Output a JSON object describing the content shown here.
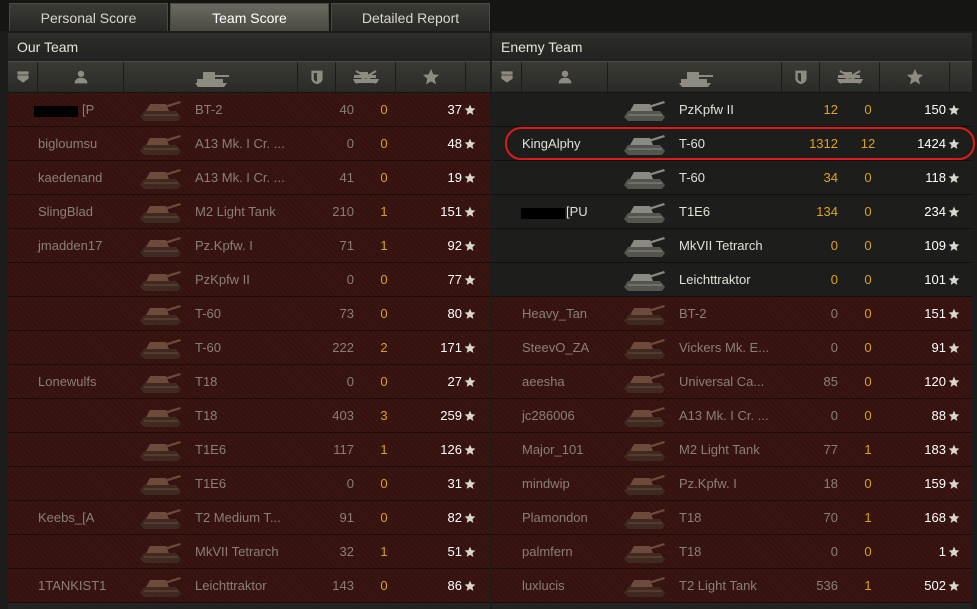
{
  "tabs": [
    {
      "label": "Personal Score",
      "active": false
    },
    {
      "label": "Team Score",
      "active": true
    },
    {
      "label": "Detailed Report",
      "active": false
    }
  ],
  "our_team": {
    "title": "Our Team",
    "rows": [
      {
        "name": "[P",
        "masked": true,
        "tank": "BT-2",
        "damage": "40",
        "kills": "0",
        "score": "37",
        "alive": false
      },
      {
        "name": "bigloumsu",
        "masked": false,
        "tank": "A13 Mk. I Cr. ...",
        "damage": "0",
        "kills": "0",
        "score": "48",
        "alive": false
      },
      {
        "name": "kaedenand",
        "masked": false,
        "tank": "A13 Mk. I Cr. ...",
        "damage": "41",
        "kills": "0",
        "score": "19",
        "alive": false
      },
      {
        "name": "SlingBlad",
        "masked": false,
        "tank": "M2 Light Tank",
        "damage": "210",
        "kills": "1",
        "score": "151",
        "alive": false
      },
      {
        "name": "jmadden17",
        "masked": false,
        "tank": "Pz.Kpfw. I",
        "damage": "71",
        "kills": "1",
        "score": "92",
        "alive": false
      },
      {
        "name": "",
        "masked": true,
        "tank": "PzKpfw II",
        "damage": "0",
        "kills": "0",
        "score": "77",
        "alive": false
      },
      {
        "name": "",
        "masked": true,
        "tank": "T-60",
        "damage": "73",
        "kills": "0",
        "score": "80",
        "alive": false
      },
      {
        "name": "",
        "masked": true,
        "tank": "T-60",
        "damage": "222",
        "kills": "2",
        "score": "171",
        "alive": false
      },
      {
        "name": "Lonewulfs",
        "masked": false,
        "tank": "T18",
        "damage": "0",
        "kills": "0",
        "score": "27",
        "alive": false
      },
      {
        "name": "",
        "masked": true,
        "tank": "T18",
        "damage": "403",
        "kills": "3",
        "score": "259",
        "alive": false
      },
      {
        "name": "",
        "masked": true,
        "tank": "T1E6",
        "damage": "117",
        "kills": "1",
        "score": "126",
        "alive": false
      },
      {
        "name": "",
        "masked": true,
        "tank": "T1E6",
        "damage": "0",
        "kills": "0",
        "score": "31",
        "alive": false
      },
      {
        "name": "Keebs_[A",
        "masked": false,
        "tank": "T2 Medium T...",
        "damage": "91",
        "kills": "0",
        "score": "82",
        "alive": false
      },
      {
        "name": "",
        "masked": true,
        "tank": "MkVII Tetrarch",
        "damage": "32",
        "kills": "1",
        "score": "51",
        "alive": false
      },
      {
        "name": "1TANKIST1",
        "masked": false,
        "tank": "Leichttraktor",
        "damage": "143",
        "kills": "0",
        "score": "86",
        "alive": false
      }
    ]
  },
  "enemy_team": {
    "title": "Enemy Team",
    "rows": [
      {
        "name": "",
        "masked": true,
        "tank": "PzKpfw II",
        "damage": "12",
        "kills": "0",
        "score": "150",
        "alive": true
      },
      {
        "name": "KingAlphy",
        "masked": false,
        "tank": "T-60",
        "damage": "1312",
        "kills": "12",
        "score": "1424",
        "alive": true
      },
      {
        "name": "",
        "masked": true,
        "tank": "T-60",
        "damage": "34",
        "kills": "0",
        "score": "118",
        "alive": true
      },
      {
        "name": "[PU",
        "masked": true,
        "tank": "T1E6",
        "damage": "134",
        "kills": "0",
        "score": "234",
        "alive": true
      },
      {
        "name": "",
        "masked": true,
        "tank": "MkVII Tetrarch",
        "damage": "0",
        "kills": "0",
        "score": "109",
        "alive": true
      },
      {
        "name": "",
        "masked": true,
        "tank": "Leichttraktor",
        "damage": "0",
        "kills": "0",
        "score": "101",
        "alive": true
      },
      {
        "name": "Heavy_Tan",
        "masked": false,
        "tank": "BT-2",
        "damage": "0",
        "kills": "0",
        "score": "151",
        "alive": false
      },
      {
        "name": "SteevO_ZA",
        "masked": false,
        "tank": "Vickers Mk. E...",
        "damage": "0",
        "kills": "0",
        "score": "91",
        "alive": false
      },
      {
        "name": "aeesha",
        "masked": false,
        "tank": "Universal Ca...",
        "damage": "85",
        "kills": "0",
        "score": "120",
        "alive": false
      },
      {
        "name": "jc286006",
        "masked": false,
        "tank": "A13 Mk. I Cr. ...",
        "damage": "0",
        "kills": "0",
        "score": "88",
        "alive": false
      },
      {
        "name": "Major_101",
        "masked": false,
        "tank": "M2 Light Tank",
        "damage": "77",
        "kills": "1",
        "score": "183",
        "alive": false
      },
      {
        "name": "mindwip",
        "masked": false,
        "tank": "Pz.Kpfw. I",
        "damage": "18",
        "kills": "0",
        "score": "159",
        "alive": false
      },
      {
        "name": "Plamondon",
        "masked": false,
        "tank": "T18",
        "damage": "70",
        "kills": "1",
        "score": "168",
        "alive": false
      },
      {
        "name": "palmfern",
        "masked": false,
        "tank": "T18",
        "damage": "0",
        "kills": "0",
        "score": "1",
        "alive": false
      },
      {
        "name": "luxlucis",
        "masked": false,
        "tank": "T2 Light Tank",
        "damage": "536",
        "kills": "1",
        "score": "502",
        "alive": false
      }
    ]
  },
  "columns": {
    "icons": [
      "platoon-icon",
      "player-icon",
      "tank-icon",
      "damage-icon",
      "kills-icon",
      "score-star-icon"
    ]
  },
  "colors": {
    "kills": "#d7a418",
    "highlight": "#e0191c",
    "dead_row": "#3a1512"
  }
}
